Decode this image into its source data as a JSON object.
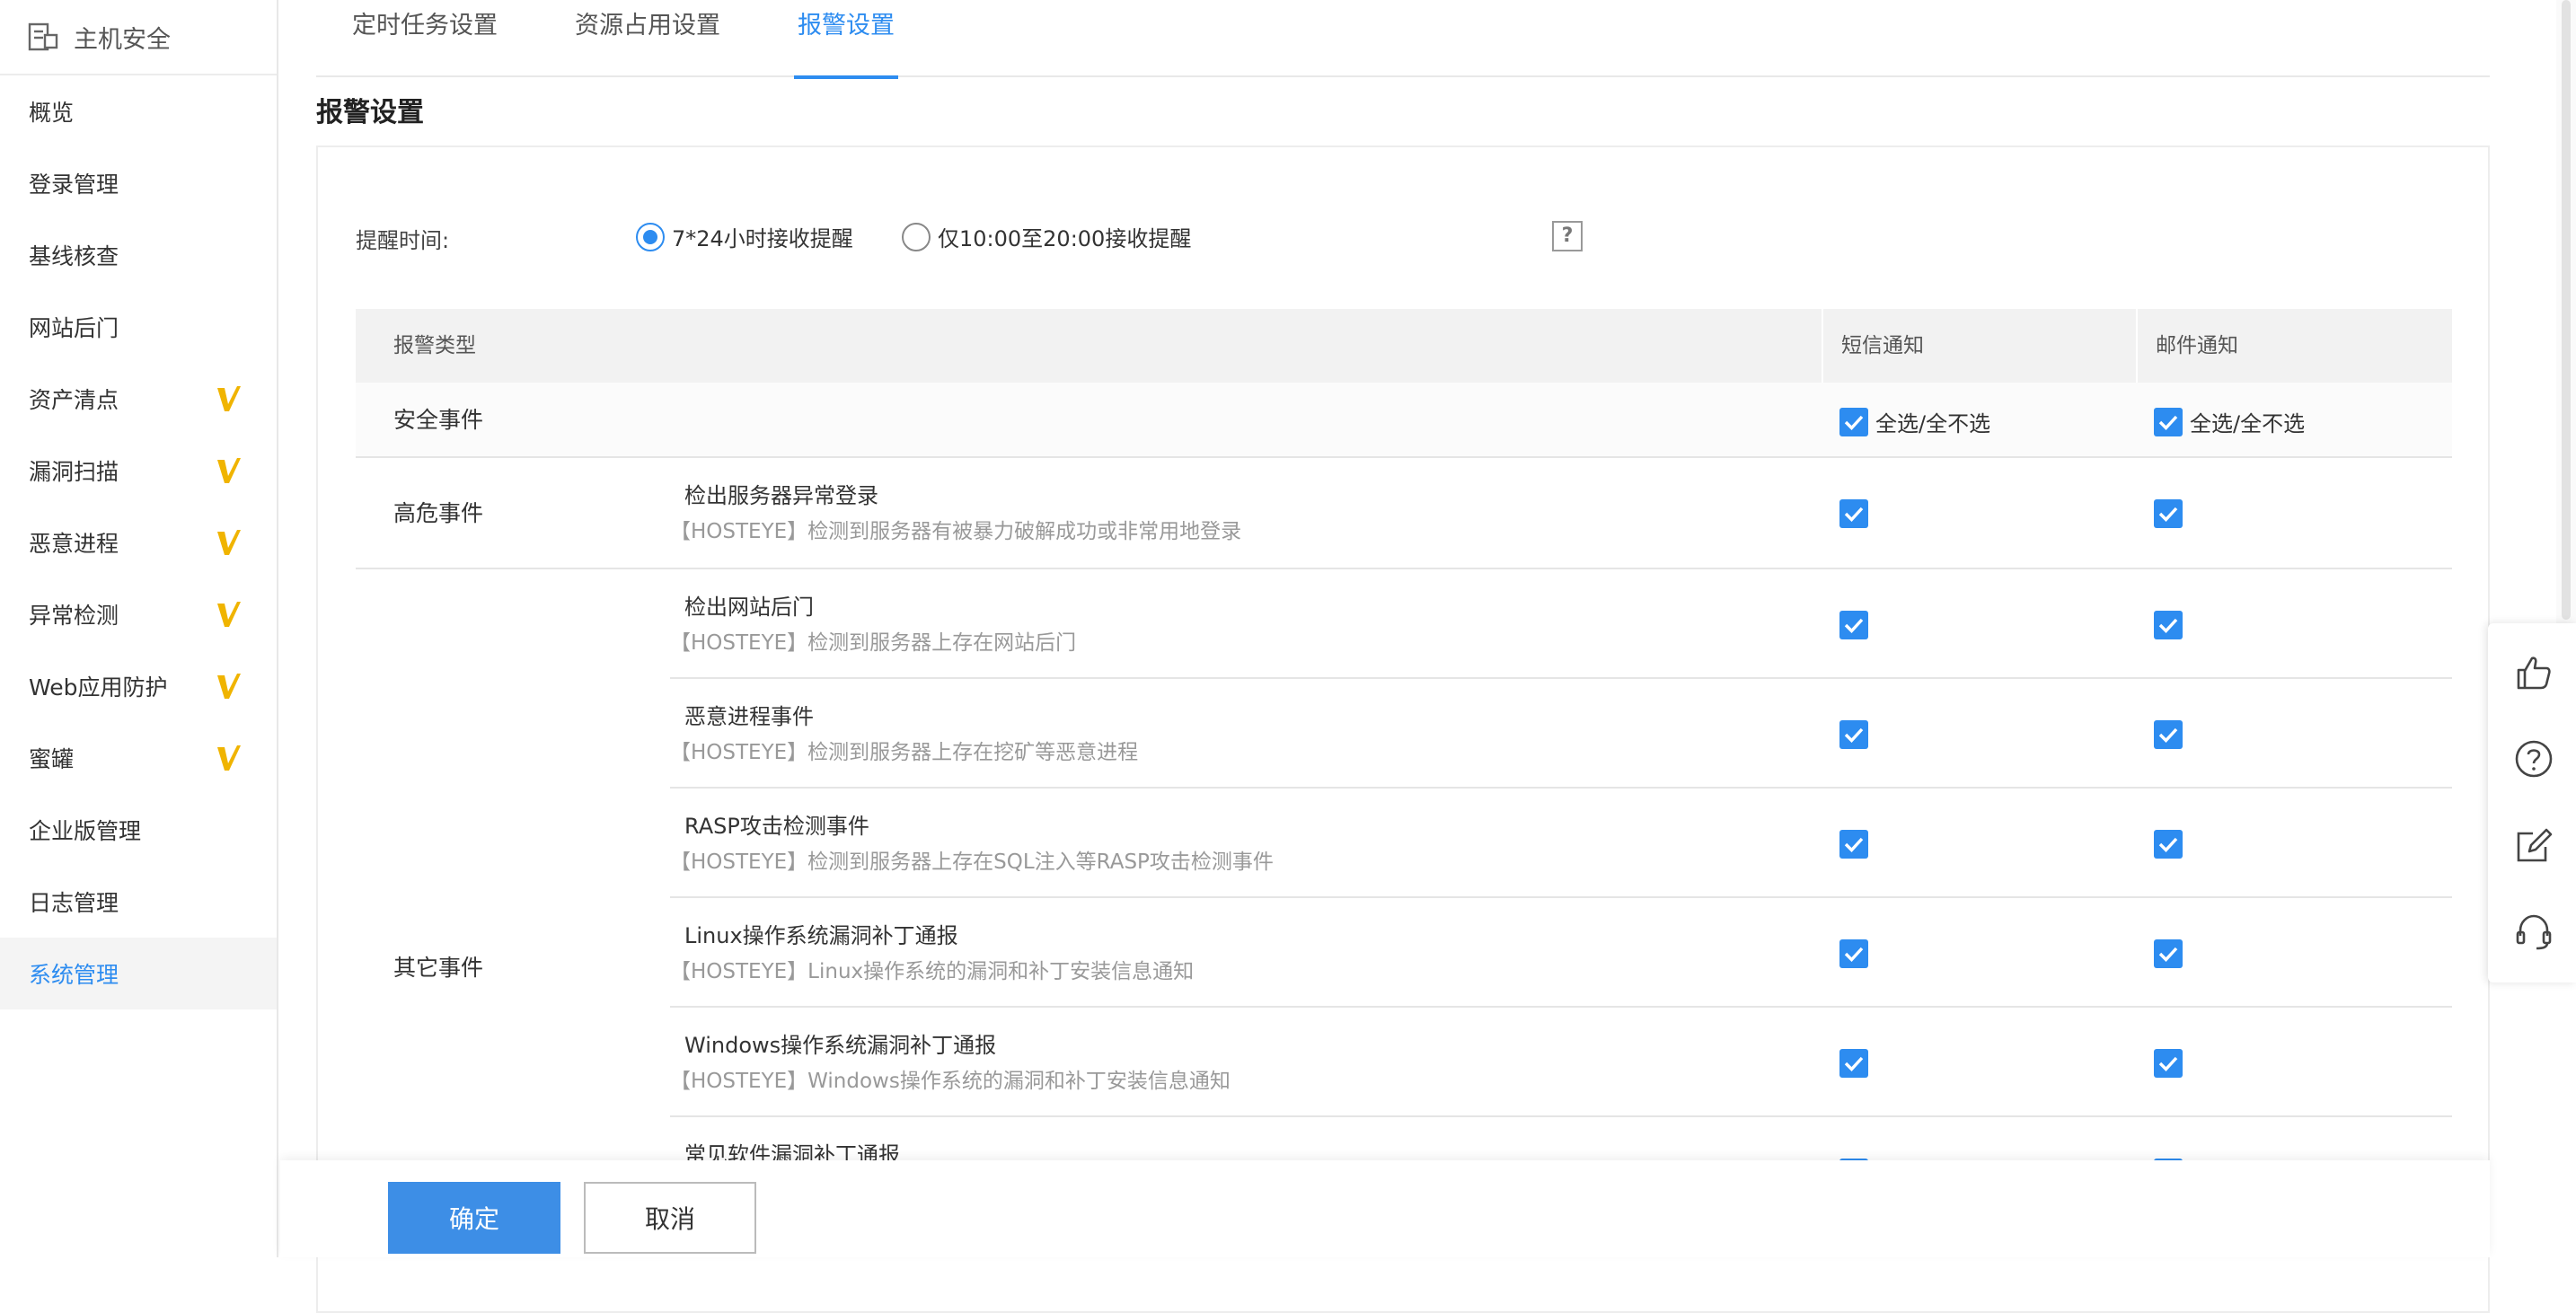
{
  "brand": {
    "title": "主机安全",
    "icon": "server-icon"
  },
  "sidebar": {
    "items": [
      {
        "label": "概览",
        "badge": false,
        "active": false
      },
      {
        "label": "登录管理",
        "badge": false,
        "active": false
      },
      {
        "label": "基线核查",
        "badge": false,
        "active": false
      },
      {
        "label": "网站后门",
        "badge": false,
        "active": false
      },
      {
        "label": "资产清点",
        "badge": true,
        "active": false
      },
      {
        "label": "漏洞扫描",
        "badge": true,
        "active": false
      },
      {
        "label": "恶意进程",
        "badge": true,
        "active": false
      },
      {
        "label": "异常检测",
        "badge": true,
        "active": false
      },
      {
        "label": "Web应用防护",
        "badge": true,
        "active": false
      },
      {
        "label": "蜜罐",
        "badge": true,
        "active": false
      },
      {
        "label": "企业版管理",
        "badge": false,
        "active": false
      },
      {
        "label": "日志管理",
        "badge": false,
        "active": false
      },
      {
        "label": "系统管理",
        "badge": false,
        "active": true
      }
    ],
    "badge_icon": "v-badge-icon"
  },
  "tabs": [
    {
      "label": "定时任务设置",
      "active": false
    },
    {
      "label": "资源占用设置",
      "active": false
    },
    {
      "label": "报警设置",
      "active": true
    }
  ],
  "section_title": "报警设置",
  "reminder": {
    "label": "提醒时间:",
    "options": [
      {
        "label": "7*24小时接收提醒",
        "checked": true
      },
      {
        "label": "仅10:00至20:00接收提醒",
        "checked": false
      }
    ],
    "help": "?"
  },
  "table": {
    "headers": {
      "type": "报警类型",
      "sms": "短信通知",
      "email": "邮件通知"
    },
    "security_row": {
      "label": "安全事件",
      "select_all": "全选/全不选"
    },
    "groups": [
      {
        "label": "高危事件",
        "events": [
          {
            "title": "检出服务器异常登录",
            "desc": "【HOSTEYE】检测到服务器有被暴力破解成功或非常用地登录",
            "sms": true,
            "email": true
          }
        ]
      },
      {
        "label": "其它事件",
        "events": [
          {
            "title": "检出网站后门",
            "desc": "【HOSTEYE】检测到服务器上存在网站后门",
            "sms": true,
            "email": true
          },
          {
            "title": "恶意进程事件",
            "desc": "【HOSTEYE】检测到服务器上存在挖矿等恶意进程",
            "sms": true,
            "email": true
          },
          {
            "title": "RASP攻击检测事件",
            "desc": "【HOSTEYE】检测到服务器上存在SQL注入等RASP攻击检测事件",
            "sms": true,
            "email": true
          },
          {
            "title": "Linux操作系统漏洞补丁通报",
            "desc": "【HOSTEYE】Linux操作系统的漏洞和补丁安装信息通知",
            "sms": true,
            "email": true
          },
          {
            "title": "Windows操作系统漏洞补丁通报",
            "desc": "【HOSTEYE】Windows操作系统的漏洞和补丁安装信息通知",
            "sms": true,
            "email": true
          },
          {
            "title": "常见软件漏洞补丁通报",
            "desc": "",
            "sms": true,
            "email": true
          }
        ]
      }
    ]
  },
  "footer": {
    "confirm": "确定",
    "cancel": "取消"
  },
  "float_bar": [
    "thumbs-up-icon",
    "help-circle-icon",
    "edit-icon",
    "headset-icon"
  ],
  "colors": {
    "accent": "#2d8cf0",
    "badge": "#f0b400",
    "primary_button": "#3d8ee6"
  }
}
